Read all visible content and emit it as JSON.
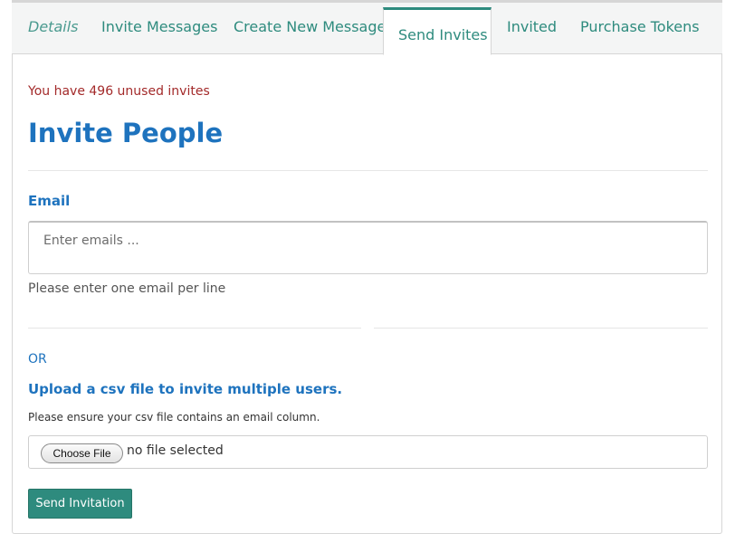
{
  "tabs": [
    {
      "label": "Details"
    },
    {
      "label": "Invite Messages"
    },
    {
      "label": "Create New Message"
    },
    {
      "label": "Send Invites"
    },
    {
      "label": "Invited"
    },
    {
      "label": "Purchase Tokens"
    }
  ],
  "active_tab": "Send Invites",
  "notice": "You have 496 unused invites",
  "page_title": "Invite People",
  "email": {
    "label": "Email",
    "placeholder": "Enter emails ...",
    "value": "",
    "help": "Please enter one email per line"
  },
  "or_text": "OR",
  "upload": {
    "title": "Upload a csv file to invite multiple users.",
    "note": "Please ensure your csv file contains an email column.",
    "choose_label": "Choose File",
    "file_status": "no file selected"
  },
  "submit_label": "Send Invitation",
  "colors": {
    "accent": "#2e8b7e",
    "heading": "#1e73be",
    "notice": "#a32a2a"
  }
}
